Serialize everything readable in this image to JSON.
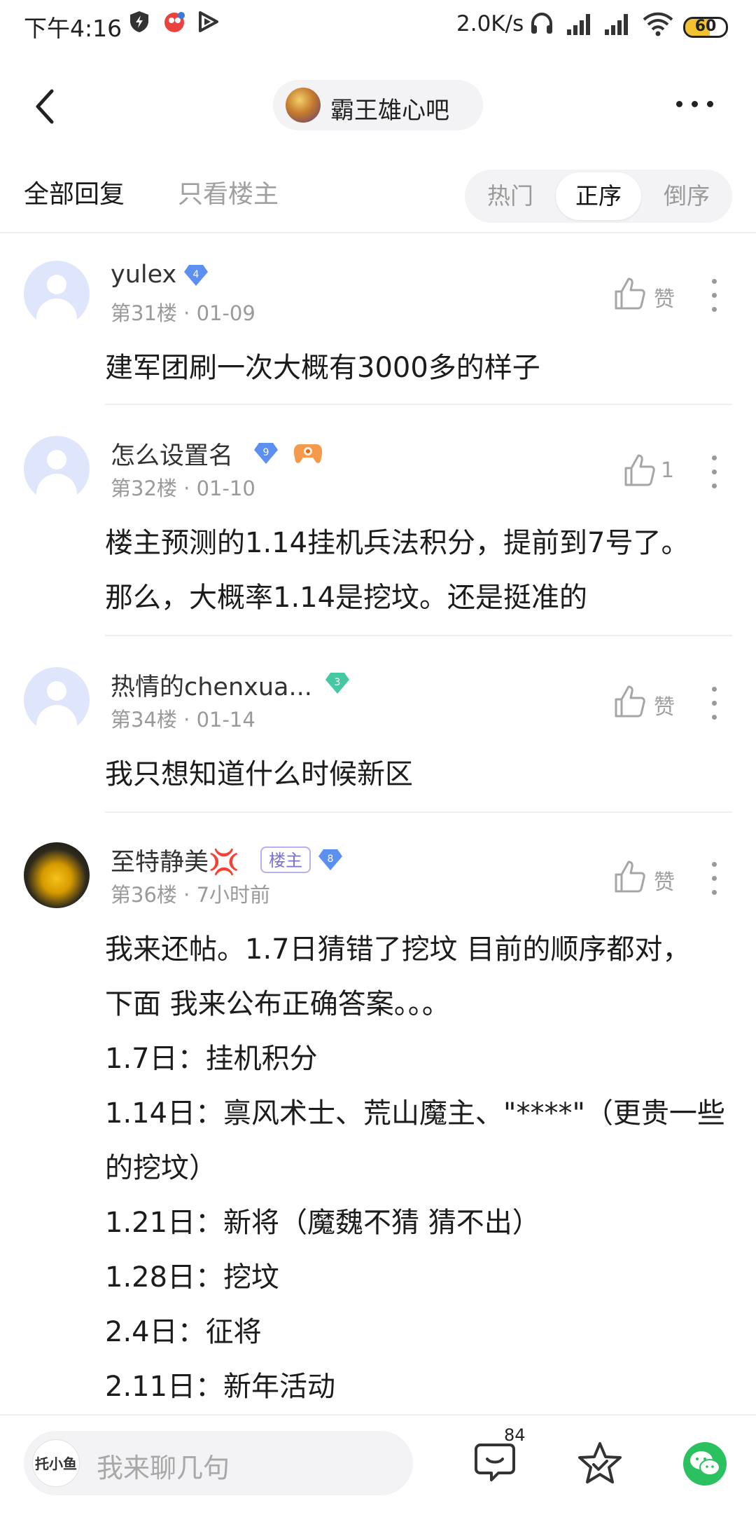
{
  "status_bar": {
    "time": "下午4:16",
    "net_speed": "2.0K/s",
    "battery": "60",
    "battery_level": 0.6,
    "icons": [
      "shield-icon",
      "app-notification-icon",
      "play-icon",
      "headset-icon",
      "signal-icon",
      "signal-icon",
      "wifi-icon",
      "battery-icon"
    ]
  },
  "header": {
    "back_icon": "chevron-left-icon",
    "forum_name": "霸王雄心吧",
    "more_icon": "more-dots-icon"
  },
  "tabs": {
    "all_replies": "全部回复",
    "op_only": "只看楼主",
    "sort_options": [
      "热门",
      "正序",
      "倒序"
    ],
    "sort_selected": "正序"
  },
  "posts": [
    {
      "username": "yulex",
      "level": "4",
      "level_color": "#5b8ff0",
      "floor": "第31楼",
      "dot": "·",
      "date": "01-09",
      "like_label": "赞",
      "lines": [
        "建军团刷一次大概有3000多的样子"
      ]
    },
    {
      "username": "怎么设置名",
      "level": "9",
      "level_color": "#5b8ff0",
      "extra_badge": "controller-badge-icon",
      "floor": "第32楼",
      "dot": "·",
      "date": "01-10",
      "like_label": "1",
      "lines": [
        "楼主预测的1.14挂机兵法积分，提前到7号了。",
        "那么，大概率1.14是挖坟。还是挺准的"
      ]
    },
    {
      "username": "热情的chenxua...",
      "level": "3",
      "level_color": "#46c8a3",
      "floor": "第34楼",
      "dot": "·",
      "date": "01-14",
      "like_label": "赞",
      "lines": [
        "我只想知道什么时候新区"
      ]
    },
    {
      "username": "至特静美💢",
      "owner_tag": "楼主",
      "level": "8",
      "level_color": "#5b8ff0",
      "floor": "第36楼",
      "dot": "·",
      "date": "7小时前",
      "like_label": "赞",
      "lines": [
        "我来还帖。1.7日猜错了挖坟 目前的顺序都对，",
        "下面 我来公布正确答案。。。",
        "1.7日：挂机积分",
        "1.14日：禀风术士、荒山魔主、\"****\"（更贵一些",
        "的挖坟）",
        "1.21日：新将（魔魏不猜 猜不出）",
        "1.28日：挖坟",
        "2.4日：征将",
        "2.11日：新年活动"
      ]
    }
  ],
  "bottom_bar": {
    "input_placeholder": "我来聊几句",
    "user_avatar_text": "托小鱼",
    "comment_count": "84",
    "icons": [
      "comment-icon",
      "star-icon",
      "wechat-icon"
    ]
  }
}
